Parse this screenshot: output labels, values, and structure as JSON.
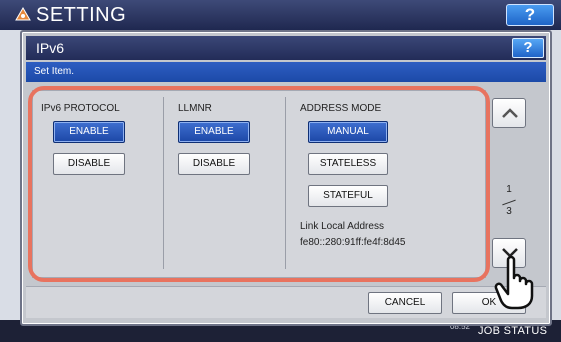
{
  "background": {
    "title": "SETTING",
    "help_label": "?",
    "clock": "08:52",
    "job_status": "JOB STATUS"
  },
  "dialog": {
    "title": "IPv6",
    "help_label": "?",
    "subtitle": "Set Item."
  },
  "columns": {
    "ipv6_protocol": {
      "label": "IPv6 PROTOCOL",
      "enable": "ENABLE",
      "disable": "DISABLE",
      "selected": "ENABLE"
    },
    "llmnr": {
      "label": "LLMNR",
      "enable": "ENABLE",
      "disable": "DISABLE",
      "selected": "ENABLE"
    },
    "address_mode": {
      "label": "ADDRESS MODE",
      "manual": "MANUAL",
      "stateless": "STATELESS",
      "stateful": "STATEFUL",
      "selected": "MANUAL",
      "link_local_label": "Link Local Address",
      "link_local_value": "fe80::280:91ff:fe4f:8d45"
    }
  },
  "pager": {
    "current": "1",
    "total": "3"
  },
  "footer": {
    "cancel": "CANCEL",
    "ok": "OK"
  },
  "colors": {
    "selected_button": "#1c47a6",
    "highlight": "#e8735f",
    "header": "#232c58"
  }
}
